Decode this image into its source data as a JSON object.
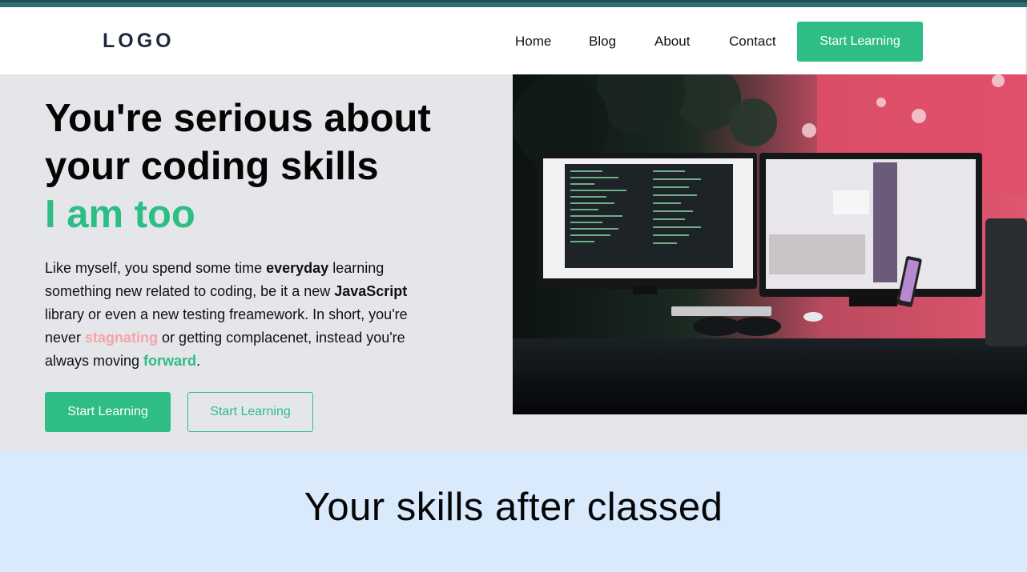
{
  "nav": {
    "logo": "LOGO",
    "links": [
      "Home",
      "Blog",
      "About",
      "Contact"
    ],
    "cta_label": "Start Learning"
  },
  "hero": {
    "headline": "You're serious about your coding skills",
    "headline_accent": "I am too",
    "paragraph": {
      "p1": "Like myself, you spend some time ",
      "b1": "everyday",
      "p2": " learning something new related to coding, be it a new ",
      "b2": "JavaScript",
      "p3": " library or even a new testing freamework. In short, you're never ",
      "pink": "stagnating",
      "p4": " or getting complacenet, instead you're always moving ",
      "green": "forward",
      "p5": "."
    },
    "primary_button": "Start Learning",
    "secondary_button": "Start Learning",
    "image_icon": "desk-setup-photo"
  },
  "skills": {
    "title": "Your skills after classed"
  },
  "colors": {
    "accent": "#2ebd85",
    "pink": "#f6a3a6",
    "hero_bg": "#e5e6ea",
    "skills_bg": "#d9eafc",
    "top_bar": "#2f6f73",
    "logo": "#1e2a3b"
  }
}
